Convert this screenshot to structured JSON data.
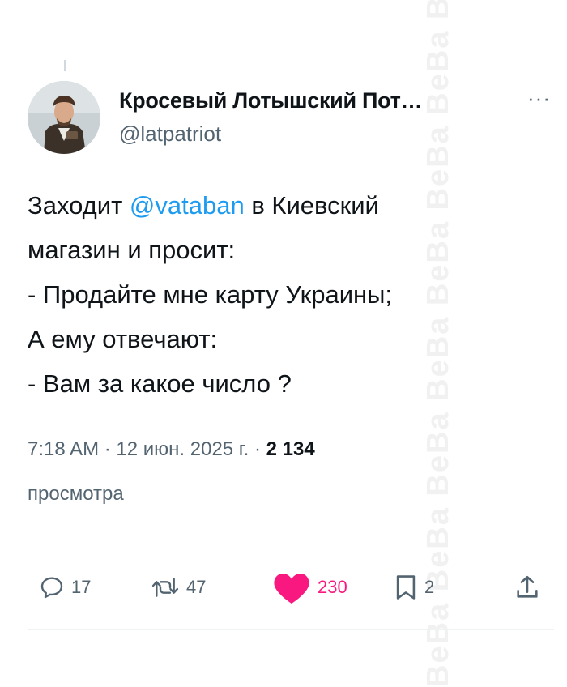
{
  "tweet": {
    "author_name": "Кросевый Лотышский Пот…",
    "author_handle": "@latpatriot",
    "more_label": "···",
    "body": {
      "line1_before": "Заходит ",
      "mention": "@vataban",
      "line1_after": " в Киевский",
      "line2": "магазин и просит:",
      "line3": "- Продайте мне карту Украины;",
      "line4": "А ему отвечают:",
      "line5": "- Вам за какое число ?"
    },
    "meta": {
      "time_date": "7:18 AM · 12 июн. 2025 г. · ",
      "views_count": "2 134",
      "views_label": "просмотра"
    },
    "actions": {
      "replies": "17",
      "retweets": "47",
      "likes": "230",
      "bookmarks": "2"
    }
  },
  "colors": {
    "accent": "#1d9bf0",
    "like": "#f91880",
    "muted": "#536471"
  },
  "icons": [
    "reply-icon",
    "retweet-icon",
    "heart-icon",
    "bookmark-icon",
    "share-icon"
  ],
  "watermark": "BeBa BeBa BeBa BeBa BeBa BeBa BeBa BeBa"
}
